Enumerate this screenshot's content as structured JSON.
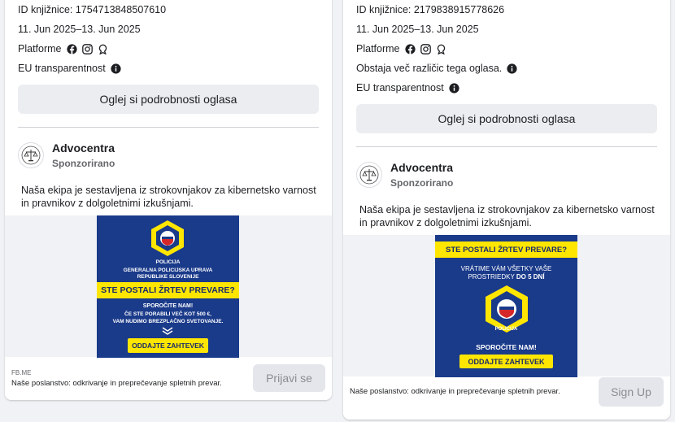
{
  "cards": [
    {
      "library_id": "ID knjižnice: 1754713848507610",
      "dates": "11. Jun 2025–13. Jun 2025",
      "platforms_label": "Platforme",
      "eu_label": "EU transparentnost",
      "details_button": "Oglej si podrobnosti oglasa",
      "advertiser": "Advocentra",
      "sponsored": "Sponzorirano",
      "body": "Naša ekipa je sestavljena iz strokovnjakov za kibernetsko varnost in pravnikov z dolgoletnimi izkušnjami.",
      "creative": {
        "line1": "GENERALNA POLICIJSKA UPRAVA",
        "line2": "REPUBLIKE SLOVENIJE",
        "headline": "STE POSTALI ŽRTEV PREVARE?",
        "sub1": "SPOROČITE NAM!",
        "sub2": "ČE STE PORABILI VEČ KOT 500 €,",
        "sub3": "VAM NUDIMO BREZPLAČNO SVETOVANJE.",
        "button": "ODDAJTE ZAHTEVEK",
        "badge": "POLICIJA"
      },
      "footer_domain": "FB.ME",
      "footer_title": "Naše poslanstvo: odkrivanje in preprečevanje spletnih prevar.",
      "cta": "Prijavi se"
    },
    {
      "library_id": "ID knjižnice: 2179838915778626",
      "dates": "11. Jun 2025–13. Jun 2025",
      "platforms_label": "Platforme",
      "versions_note": "Obstaja več različic tega oglasa.",
      "eu_label": "EU transparentnost",
      "details_button": "Oglej si podrobnosti oglasa",
      "advertiser": "Advocentra",
      "sponsored": "Sponzorirano",
      "body": "Naša ekipa je sestavljena iz strokovnjakov za kibernetsko varnost in pravnikov z dolgoletnimi izkušnjami.",
      "creative": {
        "headline": "STE POSTALI ŽRTEV PREVARE?",
        "sub1": "VRÁTIME VÁM VŠETKY VAŠE",
        "sub2": "PROSTRIEDKY",
        "sub2_bold": "DO 5 DNÍ",
        "sub3": "SPOROČITE NAM!",
        "button": "ODDAJTE ZAHTEVEK",
        "badge": "POLICIJA"
      },
      "footer_title": "Naše poslanstvo: odkrivanje in preprečevanje spletnih prevar.",
      "cta": "Sign Up"
    }
  ],
  "colors": {
    "creative_blue": "#1a3a8a",
    "creative_yellow": "#ffe600",
    "button_gray": "#ebedf0"
  }
}
